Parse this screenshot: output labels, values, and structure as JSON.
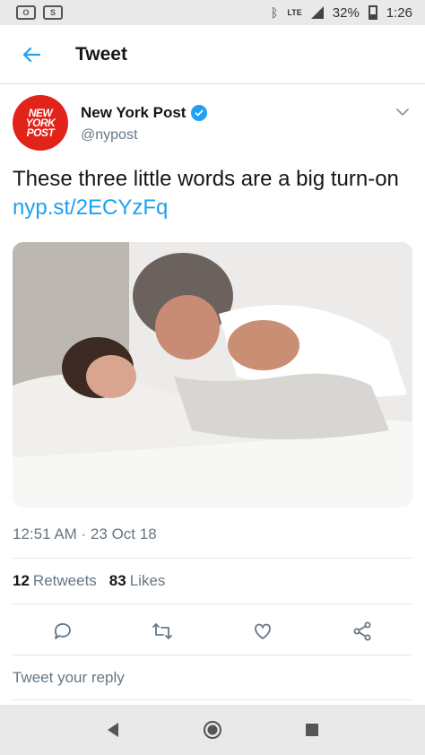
{
  "status_bar": {
    "battery": "32%",
    "time": "1:26",
    "network": "LTE"
  },
  "header": {
    "title": "Tweet"
  },
  "author": {
    "name": "New York Post",
    "handle": "@nypost",
    "avatar_lines": [
      "NEW",
      "YORK",
      "POST"
    ]
  },
  "tweet": {
    "text": "These three little words are a big turn-on ",
    "link": "nyp.st/2ECYzFq",
    "timestamp": "12:51 AM · 23 Oct 18"
  },
  "stats": {
    "retweets_count": "12",
    "retweets_label": "Retweets",
    "likes_count": "83",
    "likes_label": "Likes"
  },
  "reply": {
    "placeholder": "Tweet your reply"
  },
  "colors": {
    "accent": "#1da1f2",
    "brand_red": "#e2231a"
  },
  "icons": [
    "back-arrow-icon",
    "verified-icon",
    "chevron-down-icon",
    "reply-icon",
    "retweet-icon",
    "like-icon",
    "share-icon",
    "nav-back-icon",
    "nav-home-icon",
    "nav-recents-icon"
  ]
}
